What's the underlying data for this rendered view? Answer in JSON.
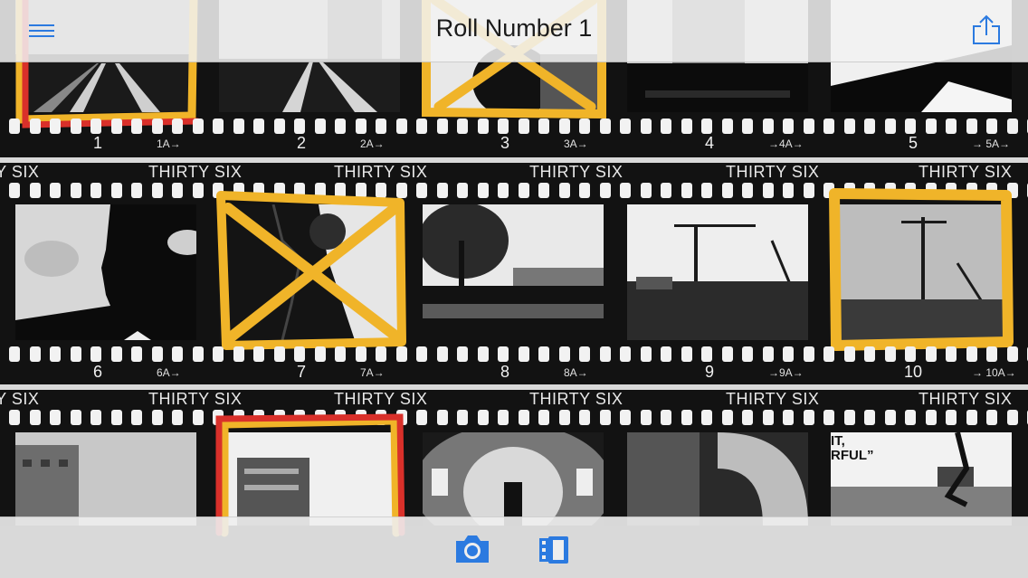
{
  "app": {
    "title": "Roll Number 1",
    "accent_color": "#2b7ae0",
    "menu_icon": "hamburger-menu-icon",
    "share_icon": "share-icon",
    "camera_icon": "camera-icon",
    "rolls_icon": "film-roll-icon"
  },
  "film": {
    "edge_code": "THIRTY SIX",
    "highlight_color": "#f0b429",
    "reject_color": "#d9302a",
    "rows": [
      {
        "frames": [
          {
            "number": "1",
            "edge": "1A→",
            "mark": "red-outline"
          },
          {
            "number": "2",
            "edge": "2A→",
            "mark": "none"
          },
          {
            "number": "3",
            "edge": "3A→",
            "mark": "yellow-cross"
          },
          {
            "number": "4",
            "edge": "→4A→",
            "mark": "none"
          },
          {
            "number": "5",
            "edge": "→  5A→",
            "mark": "none"
          }
        ]
      },
      {
        "frames": [
          {
            "number": "6",
            "edge": "6A→",
            "mark": "none"
          },
          {
            "number": "7",
            "edge": "7A→",
            "mark": "yellow-cross"
          },
          {
            "number": "8",
            "edge": "8A→",
            "mark": "none"
          },
          {
            "number": "9",
            "edge": "→9A→",
            "mark": "none"
          },
          {
            "number": "10",
            "edge": "→ 10A→",
            "mark": "yellow-outline"
          }
        ]
      },
      {
        "frames": [
          {
            "number": "",
            "edge": "",
            "mark": "none"
          },
          {
            "number": "",
            "edge": "",
            "mark": "red-outline"
          },
          {
            "number": "",
            "edge": "",
            "mark": "none"
          },
          {
            "number": "",
            "edge": "",
            "mark": "none"
          },
          {
            "number": "",
            "edge": "",
            "mark": "none"
          }
        ]
      }
    ],
    "poster_text": "IT,\nRFUL”"
  }
}
